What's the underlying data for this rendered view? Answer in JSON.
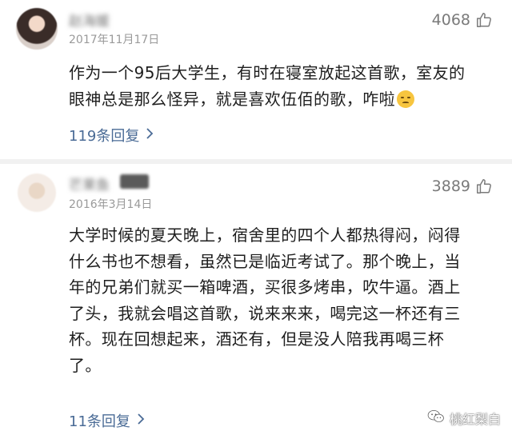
{
  "comments": [
    {
      "username": "赵海媛",
      "date": "2017年11月17日",
      "likes": "4068",
      "text_lines": [
        "作为一个95后大学生，有时在寝室放起这首歌，室友的",
        "眼神总是那么怪异，就是喜欢伍佰的歌，咋啦"
      ],
      "emoji": "pensive-face-emoji",
      "replies": "119条回复"
    },
    {
      "username": "芒果鱼",
      "date": "2016年3月14日",
      "likes": "3889",
      "text_lines": [
        "大学时候的夏天晚上，宿舍里的四个人都热得闷，闷得",
        "什么书也不想看，虽然已是临近考试了。那个晚上，当",
        "年的兄弟们就买一箱啤酒，买很多烤串，吹牛逼。酒上",
        "了头，我就会唱这首歌，说来来来，喝完这一杯还有三",
        "杯。现在回想起来，酒还有，但是没人陪我再喝三杯",
        "了。"
      ],
      "replies": "11条回复"
    }
  ],
  "watermark": {
    "text": "桃红梨白"
  },
  "colors": {
    "reply_link": "#4a6b96",
    "meta_gray": "#9a9a9a",
    "separator": "#f1f1f1"
  },
  "icons": {
    "like": "thumbs-up-icon",
    "reply_arrow": "chevron-right-icon",
    "watermark": "wechat-icon"
  }
}
